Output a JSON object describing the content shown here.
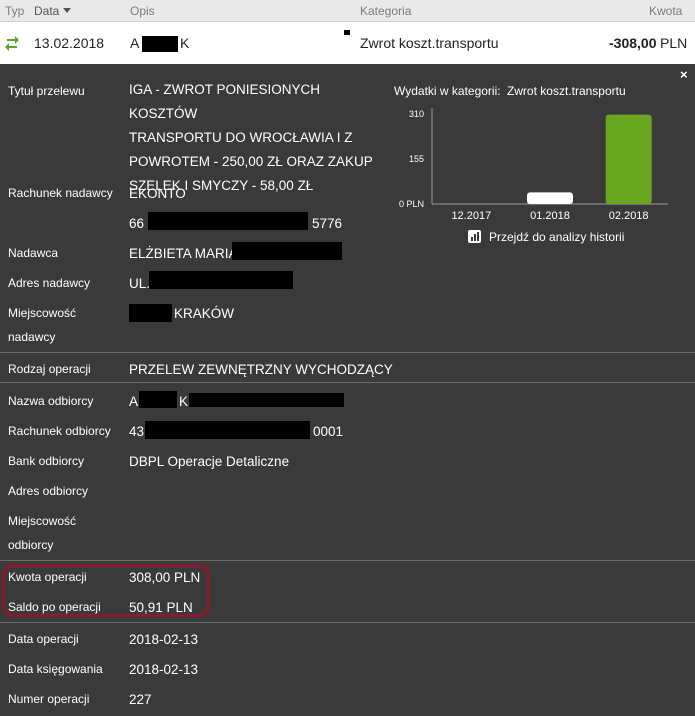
{
  "header": {
    "col_type": "Typ",
    "col_date": "Data",
    "col_desc": "Opis",
    "col_category": "Kategoria",
    "col_amount": "Kwota"
  },
  "transaction": {
    "date": "13.02.2018",
    "desc_start": "A",
    "desc_end": "K",
    "category": "Zwrot koszt.transportu",
    "amount": "-308,00",
    "currency": "PLN"
  },
  "details": {
    "title_label": "Tytuł przelewu",
    "title_lines": [
      "IGA - ZWROT PONIESIONYCH KOSZTÓW",
      "TRANSPORTU DO WROCŁAWIA I Z",
      "POWROTEM - 250,00 ZŁ ORAZ ZAKUP",
      "SZELEK I SMYCZY - 58,00 ZŁ"
    ],
    "sender_account_label": "Rachunek nadawcy",
    "sender_account_name": "EKONTO",
    "sender_account_start": "66",
    "sender_account_end": "5776",
    "sender_label": "Nadawca",
    "sender_value": "ELŻBIETA MARIA",
    "sender_address_label": "Adres nadawcy",
    "sender_address_value": "UL.",
    "sender_city_label_1": "Miejscowość",
    "sender_city_label_2": "nadawcy",
    "sender_city_value": "KRAKÓW",
    "op_type_label": "Rodzaj operacji",
    "op_type_value": "PRZELEW ZEWNĘTRZNY WYCHODZĄCY",
    "recipient_name_label": "Nazwa odbiorcy",
    "recipient_name_start": "A",
    "recipient_name_mid": "K",
    "recipient_account_label": "Rachunek odbiorcy",
    "recipient_account_start": "43",
    "recipient_account_end": "0001",
    "recipient_bank_label": "Bank odbiorcy",
    "recipient_bank_value": "DBPL Operacje Detaliczne",
    "recipient_address_label": "Adres odbiorcy",
    "recipient_city_label_1": "Miejscowość",
    "recipient_city_label_2": "odbiorcy",
    "amount_label": "Kwota operacji",
    "amount_value": "308,00 PLN",
    "balance_label": "Saldo po operacji",
    "balance_value": "50,91 PLN",
    "op_date_label": "Data operacji",
    "op_date_value": "2018-02-13",
    "posting_date_label": "Data księgowania",
    "posting_date_value": "2018-02-13",
    "op_number_label": "Numer operacji",
    "op_number_value": "227",
    "close_symbol": "×"
  },
  "chart_title_prefix": "Wydatki w kategorii:",
  "chart_title_category": "Zwrot koszt.transportu",
  "chart_link": "Przejdź do analizy historii",
  "chart_data": {
    "type": "bar",
    "categories": [
      "12.2017",
      "01.2018",
      "02.2018"
    ],
    "values": [
      0,
      40,
      308
    ],
    "ylim": [
      0,
      310
    ],
    "yticks": [
      {
        "value": 310,
        "label": "310"
      },
      {
        "value": 155,
        "label": "155"
      },
      {
        "value": 0,
        "label": "0 PLN"
      }
    ],
    "bar_colors": [
      "#ffffff",
      "#ffffff",
      "#6aa620"
    ]
  }
}
